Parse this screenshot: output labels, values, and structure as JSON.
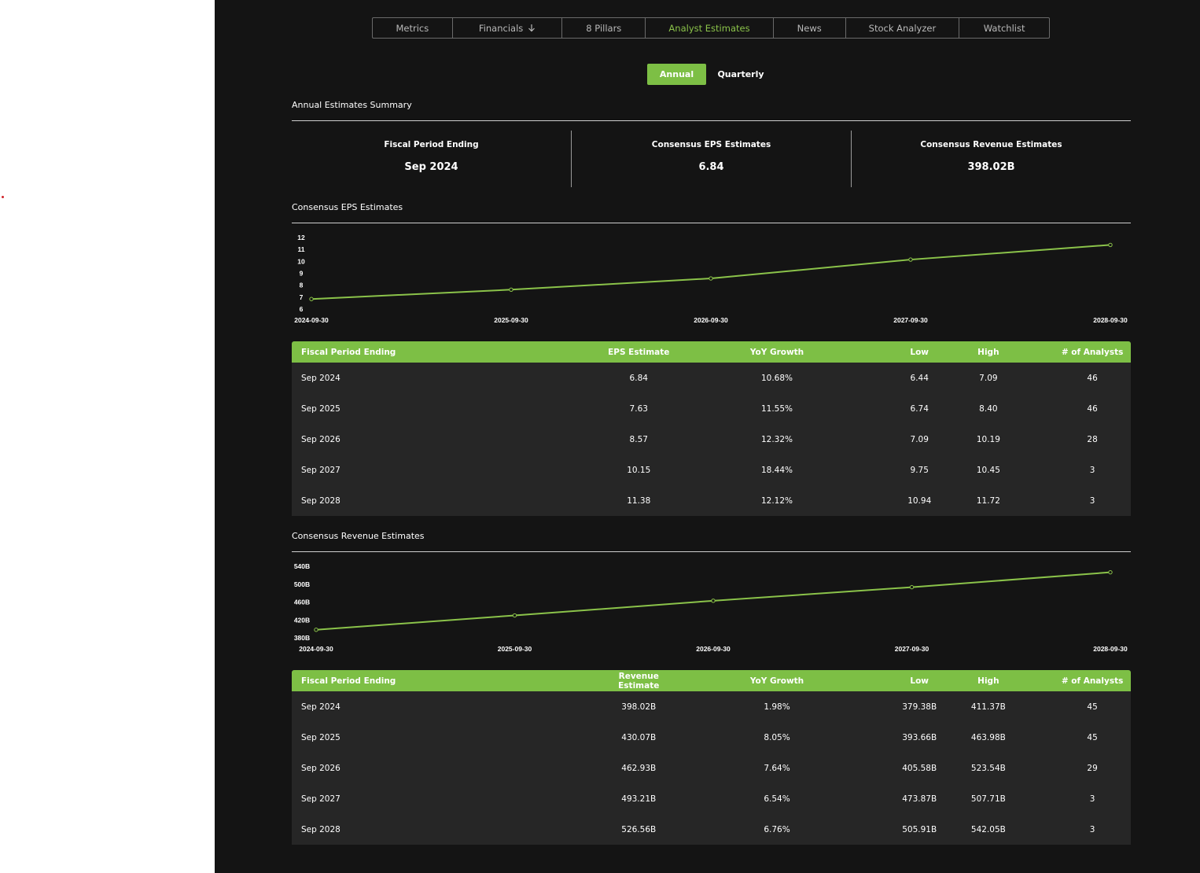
{
  "tabs": [
    {
      "label": "Metrics"
    },
    {
      "label": "Financials"
    },
    {
      "label": "8 Pillars"
    },
    {
      "label": "Analyst Estimates"
    },
    {
      "label": "News"
    },
    {
      "label": "Stock Analyzer"
    },
    {
      "label": "Watchlist"
    }
  ],
  "active_tab": "Analyst Estimates",
  "period_toggle": {
    "annual": "Annual",
    "quarterly": "Quarterly",
    "selected": "Annual"
  },
  "summary": {
    "title": "Annual Estimates Summary",
    "cols": [
      {
        "label": "Fiscal Period Ending",
        "value": "Sep 2024"
      },
      {
        "label": "Consensus EPS Estimates",
        "value": "6.84"
      },
      {
        "label": "Consensus Revenue Estimates",
        "value": "398.02B"
      }
    ]
  },
  "eps_section": {
    "title": "Consensus EPS Estimates"
  },
  "revenue_section": {
    "title": "Consensus Revenue Estimates"
  },
  "chart_data": [
    {
      "type": "line",
      "title": "Consensus EPS Estimates",
      "x": [
        "2024-09-30",
        "2025-09-30",
        "2026-09-30",
        "2027-09-30",
        "2028-09-30"
      ],
      "values": [
        6.84,
        7.63,
        8.57,
        10.15,
        11.38
      ],
      "yticks": [
        "12",
        "11",
        "10",
        "9",
        "8",
        "7",
        "6"
      ],
      "ylim": [
        6,
        12
      ],
      "color": "#8bc34a",
      "grid": false
    },
    {
      "type": "line",
      "title": "Consensus Revenue Estimates",
      "x": [
        "2024-09-30",
        "2025-09-30",
        "2026-09-30",
        "2027-09-30",
        "2028-09-30"
      ],
      "values": [
        398.02,
        430.07,
        462.93,
        493.21,
        526.56
      ],
      "yticks": [
        "540B",
        "500B",
        "460B",
        "420B",
        "380B"
      ],
      "ylim": [
        380,
        540
      ],
      "color": "#8bc34a",
      "grid": false
    }
  ],
  "eps_table": {
    "headers": [
      "Fiscal Period Ending",
      "EPS Estimate",
      "YoY Growth",
      "Low",
      "High",
      "# of Analysts"
    ],
    "rows": [
      [
        "Sep 2024",
        "6.84",
        "10.68%",
        "6.44",
        "7.09",
        "46"
      ],
      [
        "Sep 2025",
        "7.63",
        "11.55%",
        "6.74",
        "8.40",
        "46"
      ],
      [
        "Sep 2026",
        "8.57",
        "12.32%",
        "7.09",
        "10.19",
        "28"
      ],
      [
        "Sep 2027",
        "10.15",
        "18.44%",
        "9.75",
        "10.45",
        "3"
      ],
      [
        "Sep 2028",
        "11.38",
        "12.12%",
        "10.94",
        "11.72",
        "3"
      ]
    ]
  },
  "revenue_table": {
    "headers": [
      "Fiscal Period Ending",
      "Revenue Estimate",
      "YoY Growth",
      "Low",
      "High",
      "# of Analysts"
    ],
    "rows": [
      [
        "Sep 2024",
        "398.02B",
        "1.98%",
        "379.38B",
        "411.37B",
        "45"
      ],
      [
        "Sep 2025",
        "430.07B",
        "8.05%",
        "393.66B",
        "463.98B",
        "45"
      ],
      [
        "Sep 2026",
        "462.93B",
        "7.64%",
        "405.58B",
        "523.54B",
        "29"
      ],
      [
        "Sep 2027",
        "493.21B",
        "6.54%",
        "473.87B",
        "507.71B",
        "3"
      ],
      [
        "Sep 2028",
        "526.56B",
        "6.76%",
        "505.91B",
        "542.05B",
        "3"
      ]
    ]
  },
  "icons": {
    "financials_dropdown": "arrow-down-icon"
  },
  "colors": {
    "accent": "#7dbf45",
    "background": "#141414",
    "table_bg": "#262626"
  }
}
